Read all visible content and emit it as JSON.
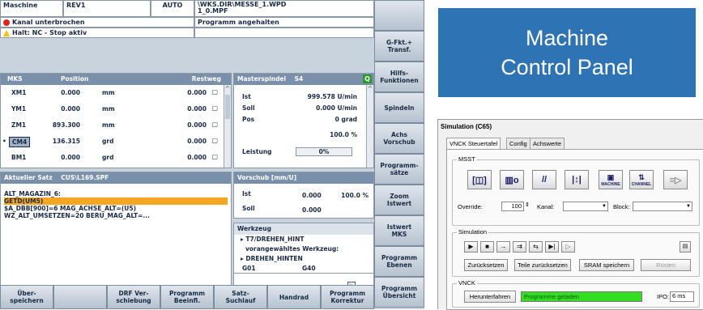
{
  "header": {
    "machine_label": "Maschine",
    "channel": "REV1",
    "mode": "AUTO",
    "path": "\\WKS.DIR\\MESSE_1.WPD",
    "file": "1_0.MPF",
    "program_state": "Programm angehalten",
    "alarm1": "Kanal unterbrochen",
    "alarm2": "Halt: NC - Stop aktiv"
  },
  "axes": {
    "title": "MKS",
    "col_pos": "Position",
    "col_rest": "Restweg",
    "rows": [
      {
        "name": "XM1",
        "pos": "0.000",
        "unit": "mm",
        "rest": "0.000",
        "marker": ""
      },
      {
        "name": "YM1",
        "pos": "0.000",
        "unit": "mm",
        "rest": "0.000",
        "marker": ""
      },
      {
        "name": "ZM1",
        "pos": "893.300",
        "unit": "mm",
        "rest": "0.000",
        "marker": ""
      },
      {
        "name": "CM4",
        "pos": "136.315",
        "unit": "grd",
        "rest": "0.000",
        "marker": "•"
      },
      {
        "name": "BM1",
        "pos": "0.000",
        "unit": "grd",
        "rest": "0.000",
        "marker": ""
      }
    ]
  },
  "spindle": {
    "title": "Masterspindel",
    "id": "S4",
    "ist_label": "Ist",
    "ist": "999.578 U/min",
    "soll_label": "Soll",
    "soll": "0.000 U/min",
    "pos_label": "Pos",
    "pos": "0 grad",
    "pct": "100.0 %",
    "leistung_label": "Leistung",
    "leistung": "0%"
  },
  "block": {
    "title": "Aktueller Satz",
    "file": "CUS\\L169.SPF",
    "lines": [
      "ALT_MAGAZIN_6:",
      "GETD(UM5)",
      "$A_DBB[900]=6 MAG_ACHSE_ALT=(U5)",
      "WZ_ALT_UMSETZEN=20 BERU_MAG_ALT=..."
    ]
  },
  "feed": {
    "title": "Vorschub [mm/U]",
    "ist_label": "Ist",
    "ist": "0.000",
    "ist_pct": "100.0 %",
    "soll_label": "Soll",
    "soll": "0.000"
  },
  "tool": {
    "title": "Werkzeug",
    "line1": "T7/DREHEN_HINT",
    "line2": "vorangewähltes Werkzeug:",
    "line3": "DREHEN_HINTEN",
    "g1": "G01",
    "g2": "G40"
  },
  "vsoftkeys": [
    "",
    "G-Fkt.+\nTransf.",
    "Hilfs-\nFunktionen",
    "Spindeln",
    "Achs\nVorschub",
    "Programm-\nsätze",
    "Zoom\nIstwert",
    "Istwert\nMKS",
    "Programm\nEbenen",
    "Programm\nÜbersicht"
  ],
  "hsoftkeys": [
    "Über-\nspeichern",
    "",
    "DRF Ver-\nschiebung",
    "Programm\nBeeinfl.",
    "Satz-\nSuchlauf",
    "Handrad",
    "Programm\nKorrektur"
  ],
  "title_box": {
    "line1": "Machine",
    "line2": "Control Panel"
  },
  "sim": {
    "title": "Simulation (C65)",
    "tabs": [
      "VNCK Steuertafel",
      "Config",
      "Achswerte"
    ],
    "msst_label": "MSST",
    "msst_buttons": [
      "[I̶]",
      "▕┃○ı",
      "|//|",
      "|↔|",
      "MACHINE",
      "CHANNEL",
      "≡▷"
    ],
    "override_label": "Override:",
    "override_value": "100",
    "kanal_label": "Kanal:",
    "block_label": "Block:",
    "sim_label": "Simulation",
    "sim_buttons": [
      "▶",
      "■",
      "→",
      "⇉",
      "⇆",
      "▶|",
      "▷"
    ],
    "zuruck": "Zurücksetzen",
    "teile": "Teile zurücksetzen",
    "sram": "SRAM speichern",
    "rusten": "Rüsten",
    "vnck_label": "VNCK",
    "herunter": "Herunterfahren",
    "status": "Programme geladen",
    "ipo_label": "IPO:",
    "ipo_value": "6 ms"
  },
  "colors": {
    "panel_header": "#7a90aa",
    "highlight": "#f5a623",
    "title_bg": "#2e74b5",
    "status_green": "#33dd22"
  }
}
